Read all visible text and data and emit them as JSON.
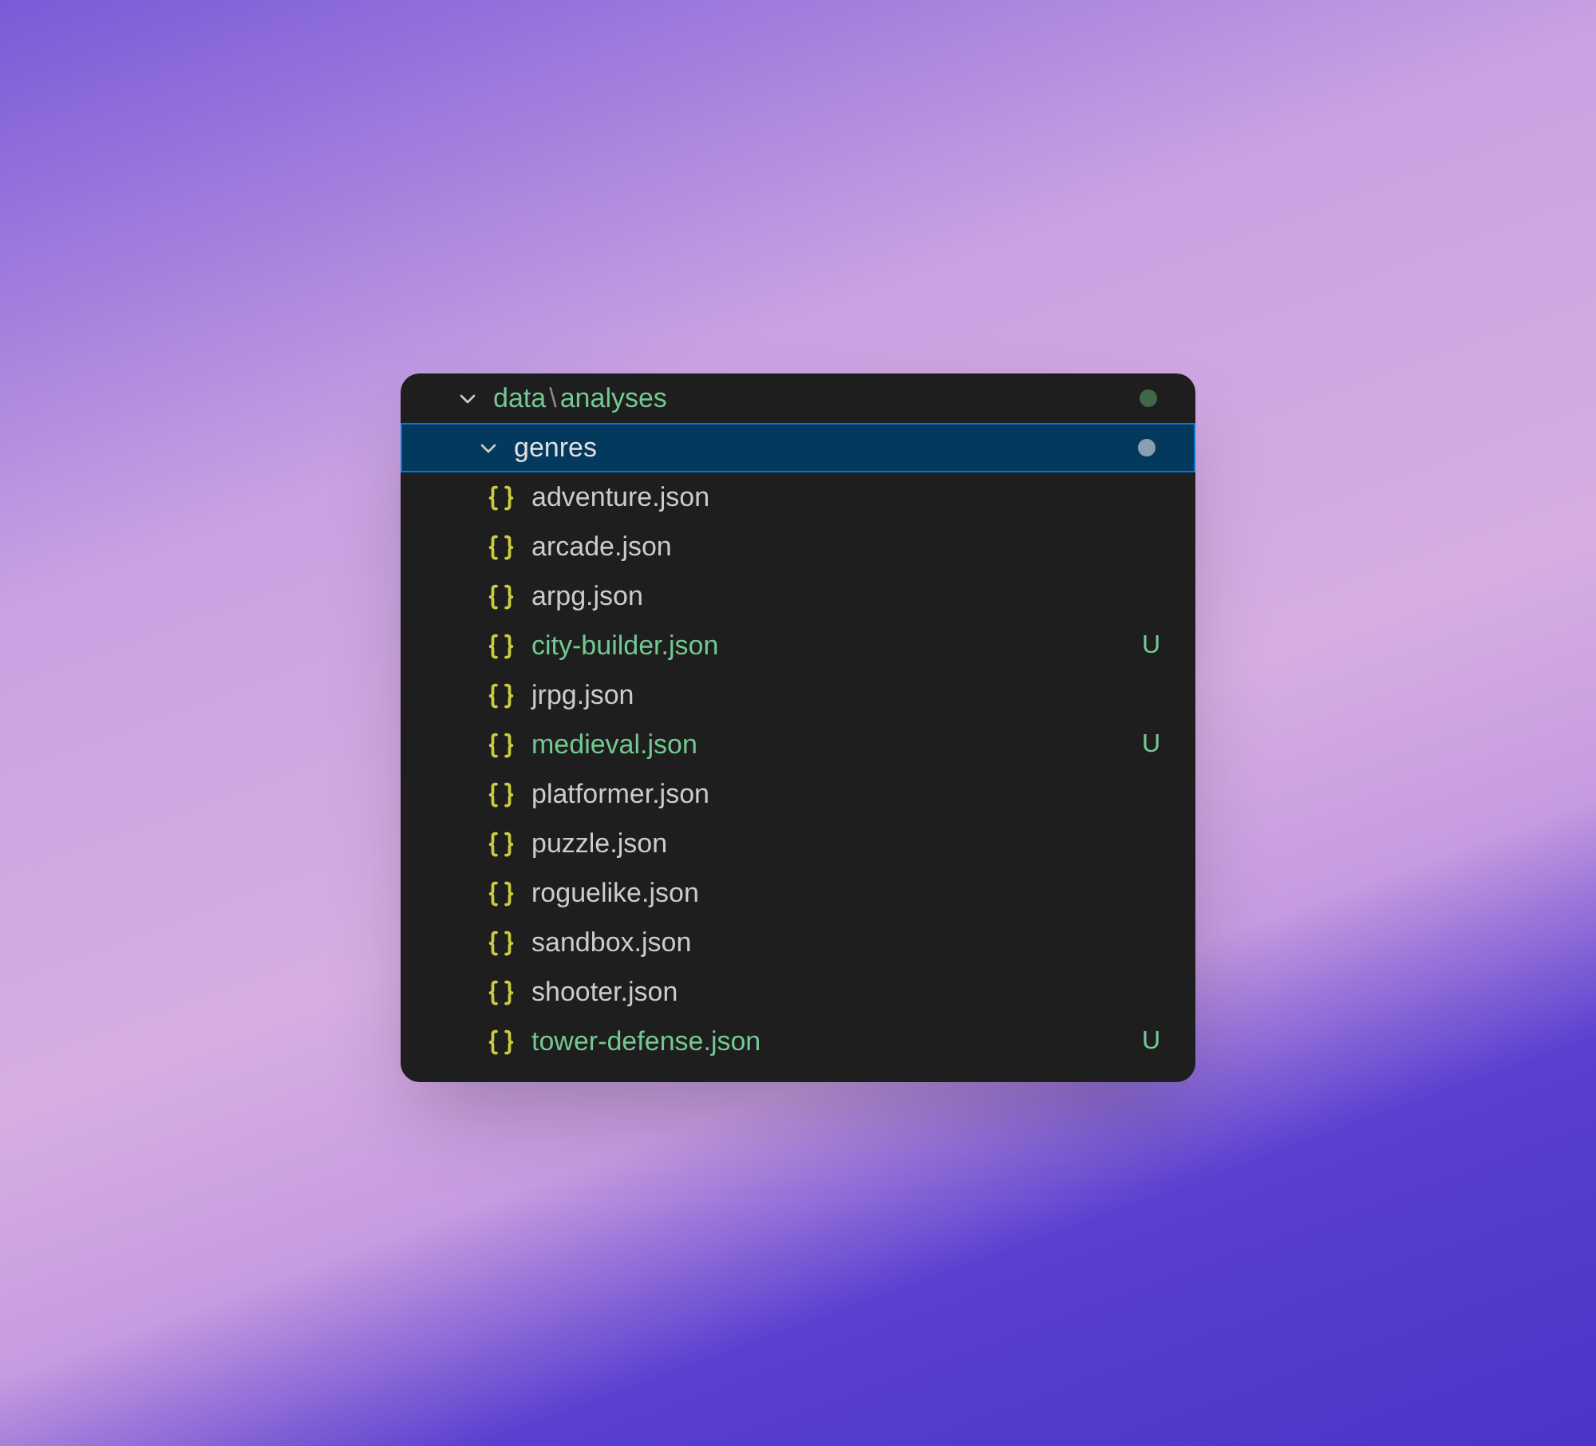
{
  "explorer": {
    "root_folder": {
      "path_segments": [
        "data",
        "analyses"
      ],
      "separator": "\\",
      "expanded": true,
      "untracked": true,
      "color": "#40694b"
    },
    "folder": {
      "name": "genres",
      "expanded": true,
      "selected": true,
      "color": "#8a9fb3"
    },
    "files": [
      {
        "name": "adventure.json",
        "untracked": false
      },
      {
        "name": "arcade.json",
        "untracked": false
      },
      {
        "name": "arpg.json",
        "untracked": false
      },
      {
        "name": "city-builder.json",
        "untracked": true,
        "badge": "U"
      },
      {
        "name": "jrpg.json",
        "untracked": false
      },
      {
        "name": "medieval.json",
        "untracked": true,
        "badge": "U"
      },
      {
        "name": "platformer.json",
        "untracked": false
      },
      {
        "name": "puzzle.json",
        "untracked": false
      },
      {
        "name": "roguelike.json",
        "untracked": false
      },
      {
        "name": "sandbox.json",
        "untracked": false
      },
      {
        "name": "shooter.json",
        "untracked": false
      },
      {
        "name": "tower-defense.json",
        "untracked": true,
        "badge": "U"
      }
    ]
  }
}
